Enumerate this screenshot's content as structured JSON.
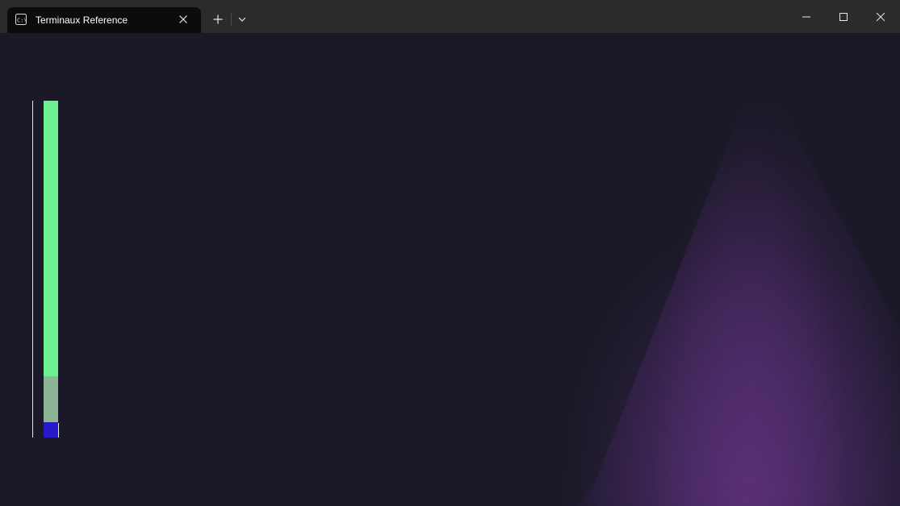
{
  "window": {
    "tab_title": "Terminaux Reference",
    "icons": {
      "tab": "terminal-icon",
      "tab_close": "close-icon",
      "new_tab": "plus-icon",
      "dropdown": "chevron-down-icon",
      "minimize": "minimize-icon",
      "maximize": "maximize-icon",
      "close": "close-icon"
    }
  },
  "terminal": {
    "background": "#1b1928",
    "stacked_bar": {
      "segments": [
        {
          "fraction": 0.818,
          "color": "#6bef91"
        },
        {
          "fraction": 0.137,
          "color": "#8db494"
        },
        {
          "fraction": 0.045,
          "color": "#2719c6"
        }
      ]
    }
  }
}
